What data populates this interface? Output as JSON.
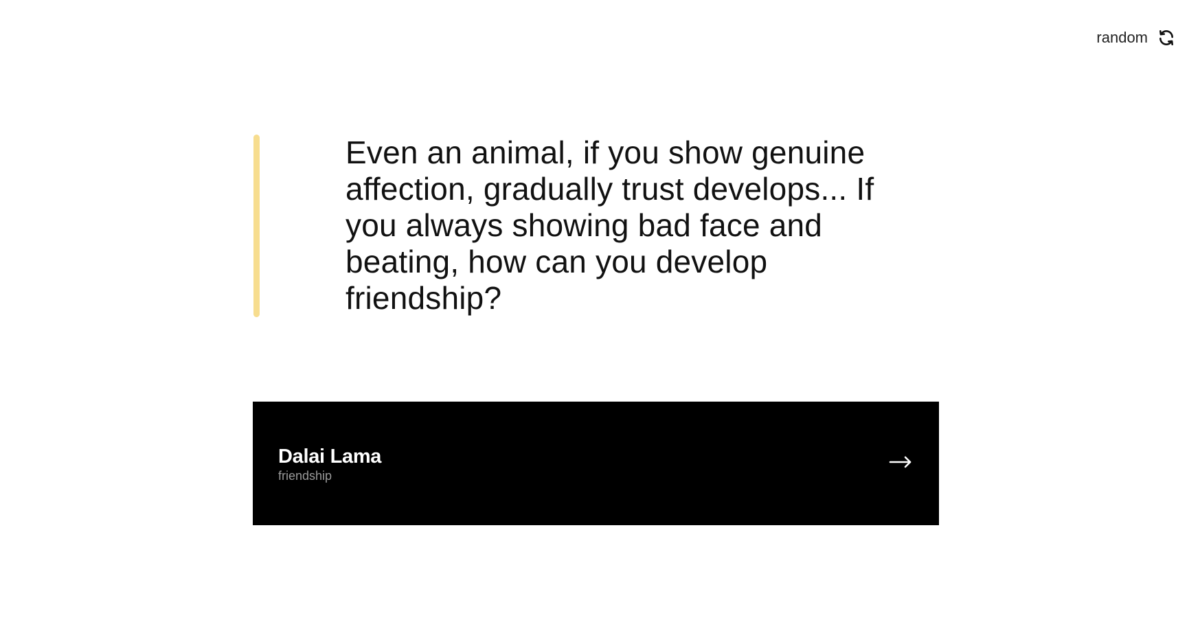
{
  "header": {
    "random_label": "random",
    "random_icon": "refresh-icon"
  },
  "quote": {
    "text": "Even an animal, if you show genuine affection, gradually trust develops... If you always showing bad face and beating, how can you develop friendship?",
    "accent_color": "#f7dd8f"
  },
  "author": {
    "name": "Dalai Lama",
    "tag": "friendship",
    "arrow_icon": "arrow-right-icon",
    "card_color": "#000000"
  }
}
